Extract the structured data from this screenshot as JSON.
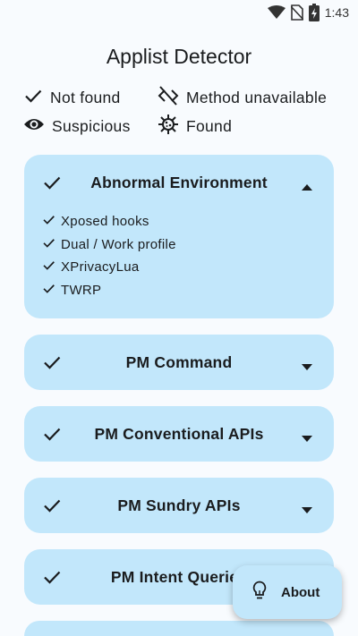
{
  "status_bar": {
    "time": "1:43",
    "icons": [
      "wifi-icon",
      "no-sim-icon",
      "battery-charging-icon"
    ]
  },
  "app": {
    "title": "Applist Detector"
  },
  "legend": {
    "not_found": "Not found",
    "method_unavailable": "Method unavailable",
    "suspicious": "Suspicious",
    "found": "Found"
  },
  "cards": [
    {
      "title": "Abnormal Environment",
      "status": "not_found",
      "expanded": true,
      "items": [
        "Xposed hooks",
        "Dual / Work profile",
        "XPrivacyLua",
        "TWRP"
      ]
    },
    {
      "title": "PM Command",
      "status": "not_found",
      "expanded": false
    },
    {
      "title": "PM Conventional APIs",
      "status": "not_found",
      "expanded": false
    },
    {
      "title": "PM Sundry APIs",
      "status": "not_found",
      "expanded": false
    },
    {
      "title": "PM Intent Queries",
      "status": "not_found",
      "expanded": false
    }
  ],
  "fab": {
    "label": "About",
    "icon": "lightbulb-icon"
  },
  "colors": {
    "background": "#f8fbfe",
    "card": "#c2e7fb",
    "text": "#1a1c1e"
  }
}
